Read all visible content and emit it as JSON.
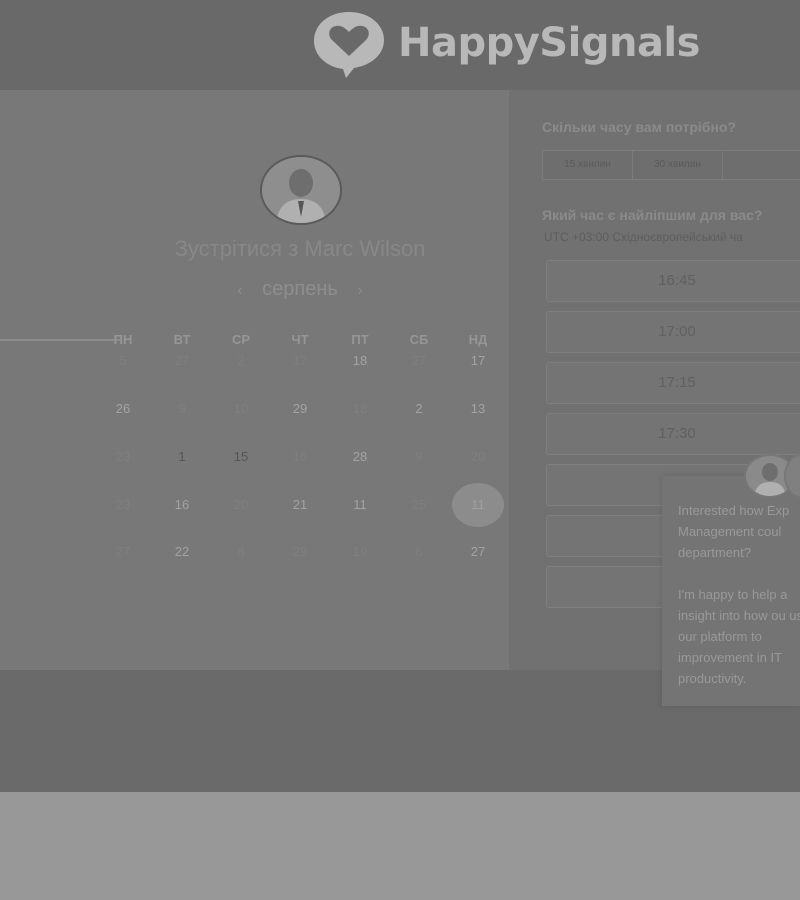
{
  "brand": {
    "name": "HappySignals",
    "logo_icon": "heart-speech-bubble-icon"
  },
  "meeting": {
    "title": "Зустрітися з Marc Wilson",
    "avatar": "person-avatar"
  },
  "calendar": {
    "month": "серпень",
    "prev_icon": "chevron-left-icon",
    "next_icon": "chevron-right-icon",
    "weekdays": [
      "ПН",
      "ВТ",
      "СР",
      "ЧТ",
      "ПТ",
      "СБ",
      "НД"
    ],
    "rows": [
      [
        "5",
        "27",
        "2",
        "17",
        "18",
        "27",
        "17"
      ],
      [
        "26",
        "9",
        "10",
        "29",
        "18",
        "2",
        "13"
      ],
      [
        "23",
        "1",
        "15",
        "16",
        "28",
        "9",
        "20"
      ],
      [
        "23",
        "16",
        "20",
        "21",
        "11",
        "25",
        "11"
      ],
      [
        "27",
        "22",
        "8",
        "29",
        "19",
        "6",
        "27"
      ]
    ],
    "selected": "11"
  },
  "duration": {
    "question": "Скільки часу вам потрібно?",
    "options": [
      "15 хвилин",
      "30 хвилин",
      ""
    ]
  },
  "time": {
    "question": "Який час є найліпшим для вас?",
    "timezone": "UTC +03:00 Східноєвропейський ча",
    "slots": [
      "16:45",
      "17:00",
      "17:15",
      "17:30",
      "",
      "",
      ""
    ]
  },
  "chat": {
    "p1": "Interested how Exp Management coul department?",
    "p2": "I'm happy to help a insight into how ou use our platform to improvement in IT productivity."
  }
}
